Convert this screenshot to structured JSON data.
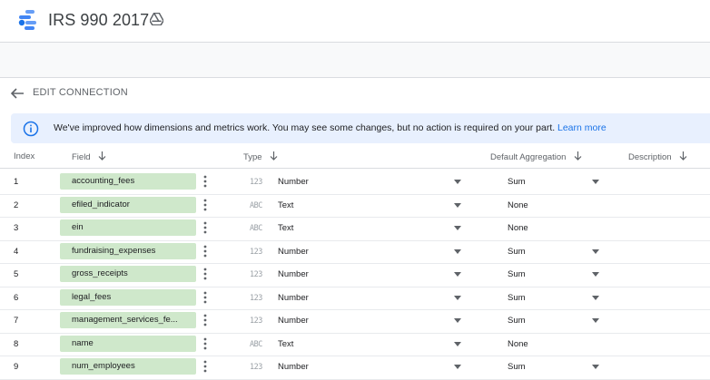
{
  "header": {
    "title": "IRS 990 2017"
  },
  "nav": {
    "edit_connection": "EDIT CONNECTION"
  },
  "banner": {
    "message": "We've improved how dimensions and metrics work. You may see some changes, but no action is required on your part.",
    "link": "Learn more"
  },
  "table": {
    "columns": {
      "index": "Index",
      "field": "Field",
      "type": "Type",
      "aggregation": "Default Aggregation",
      "description": "Description"
    },
    "rows": [
      {
        "index": "1",
        "field": "accounting_fees",
        "type_icon": "123",
        "type": "Number",
        "aggregation": "Sum",
        "agg_dropdown": true
      },
      {
        "index": "2",
        "field": "efiled_indicator",
        "type_icon": "ABC",
        "type": "Text",
        "aggregation": "None",
        "agg_dropdown": false
      },
      {
        "index": "3",
        "field": "ein",
        "type_icon": "ABC",
        "type": "Text",
        "aggregation": "None",
        "agg_dropdown": false
      },
      {
        "index": "4",
        "field": "fundraising_expenses",
        "type_icon": "123",
        "type": "Number",
        "aggregation": "Sum",
        "agg_dropdown": true
      },
      {
        "index": "5",
        "field": "gross_receipts",
        "type_icon": "123",
        "type": "Number",
        "aggregation": "Sum",
        "agg_dropdown": true
      },
      {
        "index": "6",
        "field": "legal_fees",
        "type_icon": "123",
        "type": "Number",
        "aggregation": "Sum",
        "agg_dropdown": true
      },
      {
        "index": "7",
        "field": "management_services_fe...",
        "type_icon": "123",
        "type": "Number",
        "aggregation": "Sum",
        "agg_dropdown": true
      },
      {
        "index": "8",
        "field": "name",
        "type_icon": "ABC",
        "type": "Text",
        "aggregation": "None",
        "agg_dropdown": false
      },
      {
        "index": "9",
        "field": "num_employees",
        "type_icon": "123",
        "type": "Number",
        "aggregation": "Sum",
        "agg_dropdown": true
      }
    ]
  },
  "colors": {
    "chip": "#cfe8cb",
    "banner": "#e8f0fe",
    "link": "#1a73e8",
    "logo_blue": "#4285f4"
  },
  "icons": {
    "logo": "data-studio-logo-icon",
    "drive": "google-drive-icon",
    "back": "back-arrow-icon",
    "info": "info-icon"
  }
}
